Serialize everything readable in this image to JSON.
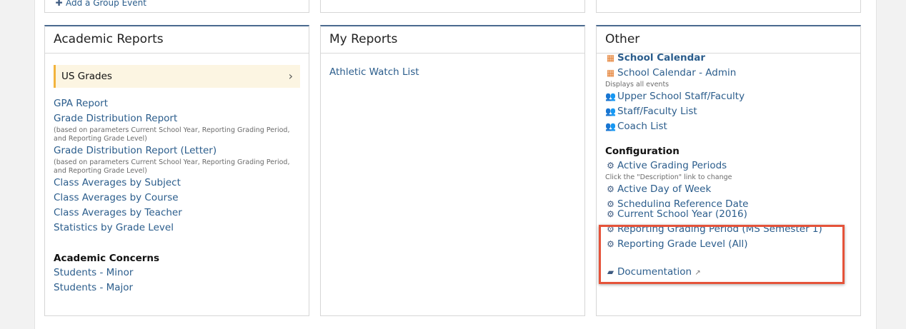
{
  "top": {
    "add_group_event": "Add a Group Event"
  },
  "academic": {
    "title": "Academic Reports",
    "us_grades": "US Grades",
    "links": [
      {
        "label": "GPA Report",
        "desc": ""
      },
      {
        "label": "Grade Distribution Report",
        "desc": "(based on parameters Current School Year, Reporting Grading Period, and Reporting Grade Level)"
      },
      {
        "label": "Grade Distribution Report (Letter)",
        "desc": "(based on parameters Current School Year, Reporting Grading Period, and Reporting Grade Level)"
      },
      {
        "label": "Class Averages by Subject",
        "desc": ""
      },
      {
        "label": "Class Averages by Course",
        "desc": ""
      },
      {
        "label": "Class Averages by Teacher",
        "desc": ""
      },
      {
        "label": "Statistics by Grade Level",
        "desc": ""
      }
    ],
    "concerns_title": "Academic Concerns",
    "concerns": [
      "Students - Minor",
      "Students - Major"
    ]
  },
  "my_reports": {
    "title": "My Reports",
    "links": [
      "Athletic Watch List"
    ]
  },
  "other": {
    "title": "Other",
    "school_calendar": "School Calendar",
    "school_calendar_admin": "School Calendar - Admin",
    "calendar_desc": "Displays all events",
    "upper_school_staff": "Upper School Staff/Faculty",
    "staff_faculty_list": "Staff/Faculty List",
    "coach_list": "Coach List",
    "configuration_title": "Configuration",
    "active_grading_periods": "Active Grading Periods",
    "grading_desc": "Click the \"Description\" link to change",
    "active_day_of_week": "Active Day of Week",
    "scheduling_reference_date": "Scheduling Reference Date",
    "current_school_year": "Current School Year (2016)",
    "reporting_grading_period": "Reporting Grading Period (MS Semester 1)",
    "reporting_grade_level": "Reporting Grade Level (All)",
    "documentation": "Documentation"
  }
}
